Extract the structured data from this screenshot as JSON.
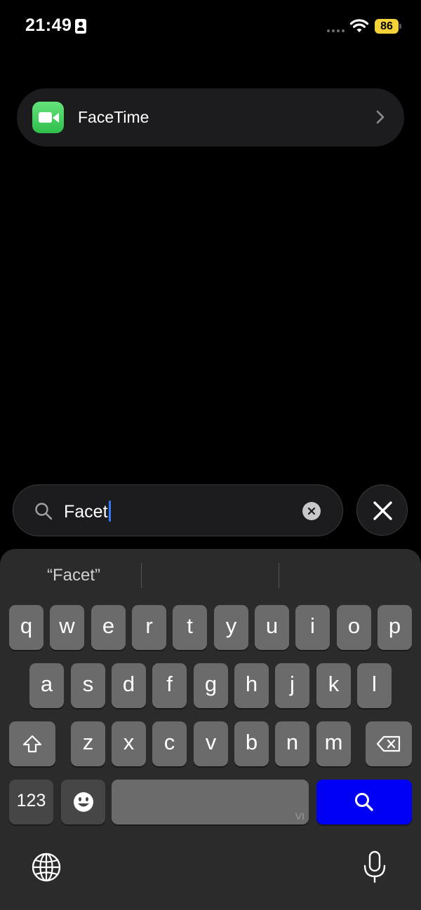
{
  "status_bar": {
    "time": "21:49",
    "battery": "86",
    "icons": [
      "contact-card-icon",
      "signal-dots-icon",
      "wifi-icon",
      "battery-icon"
    ]
  },
  "result": {
    "label": "FaceTime",
    "icon": "facetime-app-icon"
  },
  "search": {
    "value": "Facet"
  },
  "keyboard": {
    "suggestions": [
      "“Facet”",
      "",
      ""
    ],
    "row1": [
      "q",
      "w",
      "e",
      "r",
      "t",
      "y",
      "u",
      "i",
      "o",
      "p"
    ],
    "row2": [
      "a",
      "s",
      "d",
      "f",
      "g",
      "h",
      "j",
      "k",
      "l"
    ],
    "row3": [
      "z",
      "x",
      "c",
      "v",
      "b",
      "n",
      "m"
    ],
    "numbers_label": "123",
    "space_badge": "VI"
  },
  "colors": {
    "background": "#000000",
    "card": "#1c1c1e",
    "keyboard": "#2b2b2b",
    "key": "#6b6b6b",
    "search_key": "#0000f4",
    "battery": "#f4d33a",
    "facetime_green": "#3fcf5a"
  }
}
